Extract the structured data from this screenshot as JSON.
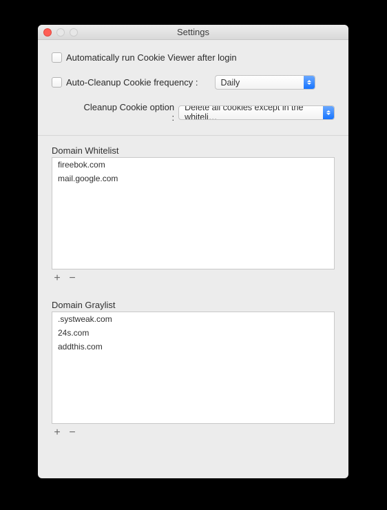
{
  "window": {
    "title": "Settings"
  },
  "top": {
    "auto_run_label": "Automatically run Cookie Viewer after login",
    "auto_cleanup_label": "Auto-Cleanup Cookie frequency :",
    "auto_cleanup_value": "Daily",
    "cleanup_option_label": "Cleanup Cookie option :",
    "cleanup_option_value": "Delete all cookies except in the whiteli…"
  },
  "whitelist": {
    "title": "Domain Whitelist",
    "items": [
      "fireebok.com",
      "mail.google.com"
    ]
  },
  "graylist": {
    "title": "Domain Graylist",
    "items": [
      ".systweak.com",
      "24s.com",
      "addthis.com"
    ]
  },
  "buttons": {
    "plus": "+",
    "minus": "−"
  }
}
